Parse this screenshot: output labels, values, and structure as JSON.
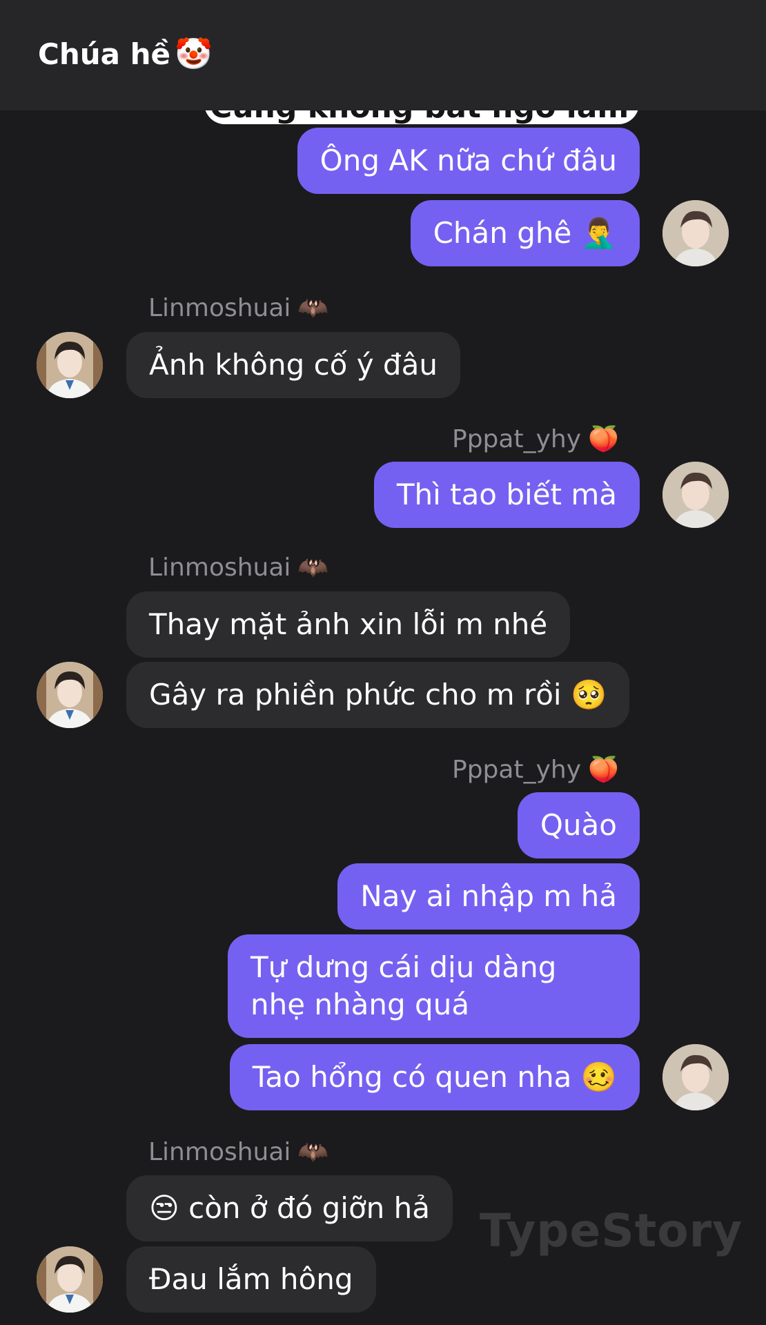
{
  "header": {
    "title": "Chúa hề",
    "title_emoji": "🤡"
  },
  "partial_top_text": "Cũng không bất ngờ lắm",
  "senders": {
    "left": {
      "name": "Linmoshuai",
      "emoji": "🦇"
    },
    "right": {
      "name": "Pppat_yhy",
      "emoji": "🍑"
    }
  },
  "messages": [
    {
      "side": "right",
      "text": "Ông AK nữa chứ đâu"
    },
    {
      "side": "right",
      "text": "Chán ghê 🤦‍♂️"
    },
    {
      "side": "left",
      "text": "Ảnh không cố ý đâu"
    },
    {
      "side": "right",
      "text": "Thì tao biết mà"
    },
    {
      "side": "left",
      "text": "Thay mặt ảnh xin lỗi m nhé"
    },
    {
      "side": "left",
      "text": "Gây ra phiền phức cho m rồi 🥺"
    },
    {
      "side": "right",
      "text": "Quào"
    },
    {
      "side": "right",
      "text": "Nay ai nhập m hả"
    },
    {
      "side": "right",
      "text": "Tự dưng cái dịu dàng nhẹ nhàng quá"
    },
    {
      "side": "right",
      "text": "Tao hổng có quen nha 🥴"
    },
    {
      "side": "left",
      "text": "😒 còn ở đó giỡn hả"
    },
    {
      "side": "left",
      "text": "Đau lắm hông"
    }
  ],
  "watermark": "TypeStory",
  "colors": {
    "background": "#1b1b1d",
    "header": "#262628",
    "outgoing_bubble": "#7561f1",
    "incoming_bubble": "#2c2c2e",
    "sender_label": "#8e8e93"
  }
}
